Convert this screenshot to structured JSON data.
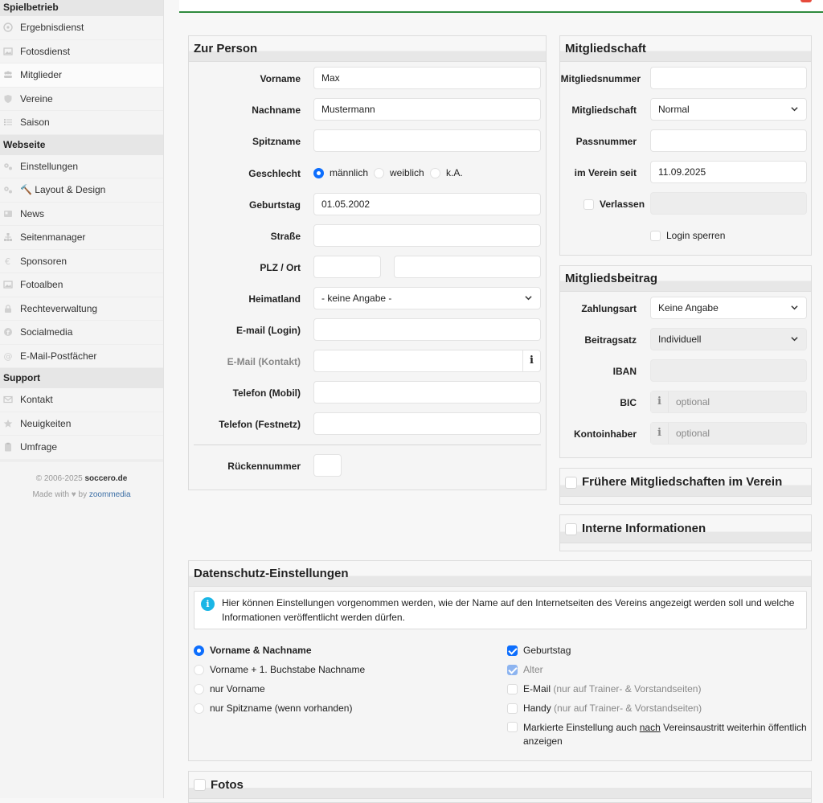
{
  "sidebar": {
    "sections": [
      {
        "title": "Spielbetrieb",
        "items": [
          {
            "label": "Ergebnisdienst",
            "icon": "football-icon"
          },
          {
            "label": "Fotosdienst",
            "icon": "image-icon"
          },
          {
            "label": "Mitglieder",
            "icon": "users-icon"
          },
          {
            "label": "Vereine",
            "icon": "shield-icon"
          },
          {
            "label": "Saison",
            "icon": "list-icon"
          }
        ]
      },
      {
        "title": "Webseite",
        "items": [
          {
            "label": "Einstellungen",
            "icon": "gears-icon"
          },
          {
            "label": "🔨 Layout & Design",
            "icon": "gears-icon"
          },
          {
            "label": "News",
            "icon": "newspaper-icon"
          },
          {
            "label": "Seitenmanager",
            "icon": "sitemap-icon"
          },
          {
            "label": "Sponsoren",
            "icon": "euro-icon"
          },
          {
            "label": "Fotoalben",
            "icon": "images-icon"
          },
          {
            "label": "Rechteverwaltung",
            "icon": "lock-icon"
          },
          {
            "label": "Socialmedia",
            "icon": "facebook-icon"
          },
          {
            "label": "E-Mail-Postfächer",
            "icon": "at-icon"
          }
        ]
      },
      {
        "title": "Support",
        "items": [
          {
            "label": "Kontakt",
            "icon": "envelope-icon"
          },
          {
            "label": "Neuigkeiten",
            "icon": "star-icon"
          },
          {
            "label": "Umfrage",
            "icon": "clipboard-icon"
          }
        ]
      }
    ],
    "footer": {
      "copyright": "© 2006-2025",
      "brand": "soccero.de",
      "made_with": "Made with",
      "by": "by",
      "company": "zoommedia"
    }
  },
  "person": {
    "title": "Zur Person",
    "vorname_label": "Vorname",
    "vorname": "Max",
    "nachname_label": "Nachname",
    "nachname": "Mustermann",
    "spitzname_label": "Spitzname",
    "spitzname": "",
    "geschlecht_label": "Geschlecht",
    "g_m": "männlich",
    "g_w": "weiblich",
    "g_ka": "k.A.",
    "geburtstag_label": "Geburtstag",
    "geburtstag": "01.05.2002",
    "strasse_label": "Straße",
    "plz_label": "PLZ / Ort",
    "heimatland_label": "Heimatland",
    "heimatland": "- keine Angabe -",
    "email_login_label": "E-mail (Login)",
    "email_kontakt_label": "E-Mail (Kontakt)",
    "info_glyph": "i",
    "tel_mobil_label": "Telefon (Mobil)",
    "tel_fest_label": "Telefon (Festnetz)",
    "ruecken_label": "Rückennummer"
  },
  "membership": {
    "title": "Mitgliedschaft",
    "nummer_label": "Mitgliedsnummer",
    "art_label": "Mitgliedschaft",
    "art": "Normal",
    "pass_label": "Passnummer",
    "seit_label": "im Verein seit",
    "seit": "11.09.2025",
    "verlassen_label": "Verlassen",
    "login_sperren": "Login sperren"
  },
  "fee": {
    "title": "Mitgliedsbeitrag",
    "zahlungsart_label": "Zahlungsart",
    "zahlungsart": "Keine Angabe",
    "satz_label": "Beitragsatz",
    "satz": "Individuell",
    "iban_label": "IBAN",
    "bic_label": "BIC",
    "bic_placeholder": "optional",
    "inhaber_label": "Kontoinhaber",
    "inhaber_placeholder": "optional"
  },
  "former": {
    "title": "Frühere Mitgliedschaften im Verein"
  },
  "internal": {
    "title": "Interne Informationen"
  },
  "privacy": {
    "title": "Datenschutz-Einstellungen",
    "info_line1": "Hier können Einstellungen vorgenommen werden, wie der Name auf den Internetseiten des Vereins angezeigt werden soll und welche",
    "info_line2": "Informationen veröffentlicht werden dürfen.",
    "name_options": [
      "Vorname & Nachname",
      "Vorname + 1. Buchstabe Nachname",
      "nur Vorname",
      "nur Spitzname (wenn vorhanden)"
    ],
    "geburtstag": "Geburtstag",
    "alter": "Alter",
    "email": "E-Mail",
    "email_note": "(nur auf Trainer- & Vorstandseiten)",
    "handy": "Handy",
    "handy_note": "(nur auf Trainer- & Vorstandseiten)",
    "marked_1": "Markierte Einstellung auch",
    "marked_nach": "nach",
    "marked_2": "Vereinsaustritt weiterhin öffentlich",
    "marked_3": "anzeigen"
  },
  "fotos": {
    "title": "Fotos"
  },
  "colors": {
    "accent": "#0d6efd",
    "topbar_line": "#2f8a3e",
    "info": "#1ab6e6"
  }
}
